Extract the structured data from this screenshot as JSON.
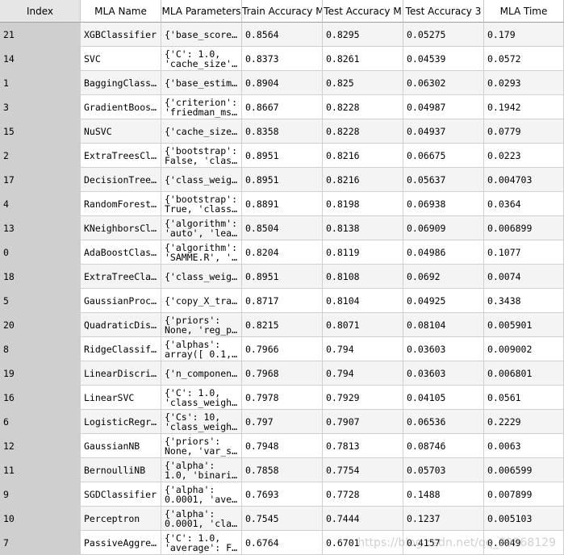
{
  "headers": [
    "Index",
    "MLA Name",
    "MLA Parameters",
    "Train Accuracy M",
    "Test Accuracy M",
    "Test Accuracy 3",
    "MLA Time"
  ],
  "rows": [
    {
      "index": "21",
      "name": "XGBClassifier",
      "params": [
        "{'base_score…"
      ],
      "train": "0.8564",
      "test": "0.8295",
      "std": "0.05275",
      "time": "0.179"
    },
    {
      "index": "14",
      "name": "SVC",
      "params": [
        "{'C': 1.0,",
        "'cache_size'…"
      ],
      "train": "0.8373",
      "test": "0.8261",
      "std": "0.04539",
      "time": "0.0572"
    },
    {
      "index": "1",
      "name": "BaggingClass…",
      "params": [
        "{'base_estim…"
      ],
      "train": "0.8904",
      "test": "0.825",
      "std": "0.06302",
      "time": "0.0293"
    },
    {
      "index": "3",
      "name": "GradientBoos…",
      "params": [
        "{'criterion':",
        "'friedman_ms…"
      ],
      "train": "0.8667",
      "test": "0.8228",
      "std": "0.04987",
      "time": "0.1942"
    },
    {
      "index": "15",
      "name": "NuSVC",
      "params": [
        "{'cache_size…"
      ],
      "train": "0.8358",
      "test": "0.8228",
      "std": "0.04937",
      "time": "0.0779"
    },
    {
      "index": "2",
      "name": "ExtraTreesCl…",
      "params": [
        "{'bootstrap':",
        "False, 'clas…"
      ],
      "train": "0.8951",
      "test": "0.8216",
      "std": "0.06675",
      "time": "0.0223"
    },
    {
      "index": "17",
      "name": "DecisionTree…",
      "params": [
        "{'class_weig…"
      ],
      "train": "0.8951",
      "test": "0.8216",
      "std": "0.05637",
      "time": "0.004703"
    },
    {
      "index": "4",
      "name": "RandomForest…",
      "params": [
        "{'bootstrap':",
        "True, 'class…"
      ],
      "train": "0.8891",
      "test": "0.8198",
      "std": "0.06938",
      "time": "0.0364"
    },
    {
      "index": "13",
      "name": "KNeighborsCl…",
      "params": [
        "{'algorithm':",
        "'auto', 'lea…"
      ],
      "train": "0.8504",
      "test": "0.8138",
      "std": "0.06909",
      "time": "0.006899"
    },
    {
      "index": "0",
      "name": "AdaBoostClas…",
      "params": [
        "{'algorithm':",
        "'SAMME.R', '…"
      ],
      "train": "0.8204",
      "test": "0.8119",
      "std": "0.04986",
      "time": "0.1077"
    },
    {
      "index": "18",
      "name": "ExtraTreeCla…",
      "params": [
        "{'class_weig…"
      ],
      "train": "0.8951",
      "test": "0.8108",
      "std": "0.0692",
      "time": "0.0074"
    },
    {
      "index": "5",
      "name": "GaussianProc…",
      "params": [
        "{'copy_X_tra…"
      ],
      "train": "0.8717",
      "test": "0.8104",
      "std": "0.04925",
      "time": "0.3438"
    },
    {
      "index": "20",
      "name": "QuadraticDis…",
      "params": [
        "{'priors':",
        "None, 'reg_p…"
      ],
      "train": "0.8215",
      "test": "0.8071",
      "std": "0.08104",
      "time": "0.005901"
    },
    {
      "index": "8",
      "name": "RidgeClassif…",
      "params": [
        "{'alphas':",
        "array([ 0.1,…"
      ],
      "train": "0.7966",
      "test": "0.794",
      "std": "0.03603",
      "time": "0.009002"
    },
    {
      "index": "19",
      "name": "LinearDiscri…",
      "params": [
        "{'n_componen…"
      ],
      "train": "0.7968",
      "test": "0.794",
      "std": "0.03603",
      "time": "0.006801"
    },
    {
      "index": "16",
      "name": "LinearSVC",
      "params": [
        "{'C': 1.0,",
        "'class_weigh…"
      ],
      "train": "0.7978",
      "test": "0.7929",
      "std": "0.04105",
      "time": "0.0561"
    },
    {
      "index": "6",
      "name": "LogisticRegr…",
      "params": [
        "{'Cs': 10,",
        "'class_weigh…"
      ],
      "train": "0.797",
      "test": "0.7907",
      "std": "0.06536",
      "time": "0.2229"
    },
    {
      "index": "12",
      "name": "GaussianNB",
      "params": [
        "{'priors':",
        "None, 'var_s…"
      ],
      "train": "0.7948",
      "test": "0.7813",
      "std": "0.08746",
      "time": "0.0063"
    },
    {
      "index": "11",
      "name": "BernoulliNB",
      "params": [
        "{'alpha':",
        "1.0, 'binari…"
      ],
      "train": "0.7858",
      "test": "0.7754",
      "std": "0.05703",
      "time": "0.006599"
    },
    {
      "index": "9",
      "name": "SGDClassifier",
      "params": [
        "{'alpha':",
        "0.0001, 'ave…"
      ],
      "train": "0.7693",
      "test": "0.7728",
      "std": "0.1488",
      "time": "0.007899"
    },
    {
      "index": "10",
      "name": "Perceptron",
      "params": [
        "{'alpha':",
        "0.0001, 'cla…"
      ],
      "train": "0.7545",
      "test": "0.7444",
      "std": "0.1237",
      "time": "0.005103"
    },
    {
      "index": "7",
      "name": "PassiveAggre…",
      "params": [
        "{'C': 1.0,",
        "'average': F…"
      ],
      "train": "0.6764",
      "test": "0.6701",
      "std": "0.4157",
      "time": "0.0049"
    }
  ],
  "watermark": "https://blog.csdn.net/qq_39968129"
}
